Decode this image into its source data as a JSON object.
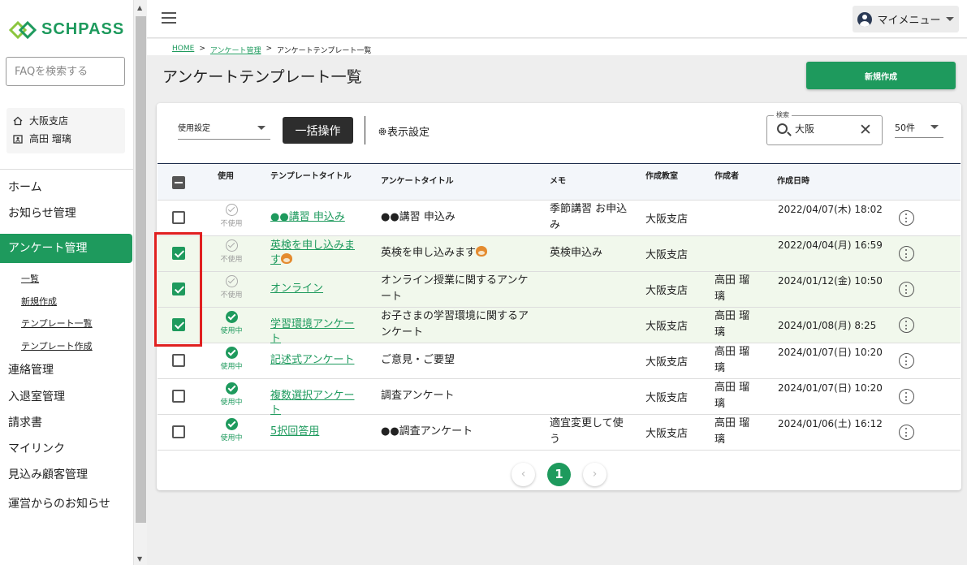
{
  "logo": {
    "text": "SCHPASS"
  },
  "search": {
    "placeholder": "FAQを検索する"
  },
  "user": {
    "branch": "大阪支店",
    "name": "高田 瑠璃"
  },
  "nav": {
    "home": "ホーム",
    "news": "お知らせ管理",
    "survey": "アンケート管理",
    "sub_list": "一覧",
    "sub_new": "新規作成",
    "sub_tpl_list": "テンプレート一覧",
    "sub_tpl_new": "テンプレート作成",
    "contact": "連絡管理",
    "entry": "入退室管理",
    "invoice": "請求書",
    "mylink": "マイリンク",
    "prospect": "見込み顧客管理",
    "operator": "運営からのお知らせ"
  },
  "topbar": {
    "mymenu": "マイメニュー"
  },
  "breadcrumb": {
    "home": "HOME",
    "parent": "アンケート管理",
    "current": "アンケートテンプレート一覧",
    "sep": ">"
  },
  "page": {
    "title": "アンケートテンプレート一覧",
    "new_button": "新規作成"
  },
  "toolbar": {
    "use_setting": "使用設定",
    "bulk": "一括操作",
    "display": "表示設定",
    "search_legend": "検索",
    "search_value": "大阪",
    "per_page": "50件"
  },
  "table": {
    "headers": {
      "use": "使用",
      "template_title": "テンプレートタイトル",
      "survey_title": "アンケートタイトル",
      "memo": "メモ",
      "room": "作成教室",
      "author": "作成者",
      "created": "作成日時"
    },
    "rows": [
      {
        "checked": false,
        "use": "不使用",
        "use_on": false,
        "tt": "●●講習 申込み",
        "at": "●●講習 申込み",
        "memo": "季節講習 お申込み",
        "room": "大阪支店",
        "author": "",
        "date": "2022/04/07(木) 18:02"
      },
      {
        "checked": true,
        "use": "不使用",
        "use_on": false,
        "tt": "英検を申し込みます",
        "at": "英検を申し込みます",
        "memo": "英検申込み",
        "room": "大阪支店",
        "author": "",
        "date": "2022/04/04(月) 16:59",
        "emoji": true
      },
      {
        "checked": true,
        "use": "不使用",
        "use_on": false,
        "tt": "オンライン",
        "at": "オンライン授業に関するアンケート",
        "memo": "",
        "room": "大阪支店",
        "author": "高田 瑠璃",
        "date": "2024/01/12(金) 10:50"
      },
      {
        "checked": true,
        "use": "使用中",
        "use_on": true,
        "tt": "学習環境アンケート",
        "at": "お子さまの学習環境に関するアンケート",
        "memo": "",
        "room": "大阪支店",
        "author": "高田 瑠璃",
        "date": "2024/01/08(月) 8:25"
      },
      {
        "checked": false,
        "use": "使用中",
        "use_on": true,
        "tt": "記述式アンケート",
        "at": "ご意見・ご要望",
        "memo": "",
        "room": "大阪支店",
        "author": "高田 瑠璃",
        "date": "2024/01/07(日) 10:20"
      },
      {
        "checked": false,
        "use": "使用中",
        "use_on": true,
        "tt": "複数選択アンケート",
        "at": "調査アンケート",
        "memo": "",
        "room": "大阪支店",
        "author": "高田 瑠璃",
        "date": "2024/01/07(日) 10:20"
      },
      {
        "checked": false,
        "use": "使用中",
        "use_on": true,
        "tt": "5択回答用",
        "at": "●●調査アンケート",
        "memo": "適宜変更して使う",
        "room": "大阪支店",
        "author": "高田 瑠璃",
        "date": "2024/01/06(土) 16:12"
      }
    ]
  },
  "pagination": {
    "current": "1",
    "prev": "‹",
    "next": "›"
  },
  "colors": {
    "brand": "#1e9a5d",
    "highlight": "#e02020"
  },
  "icons": [
    "logo-icon",
    "home-icon",
    "badge-icon",
    "menu-icon",
    "account-icon",
    "gear-icon",
    "search-icon",
    "close-icon",
    "more-vert-icon",
    "check-circle-icon"
  ]
}
